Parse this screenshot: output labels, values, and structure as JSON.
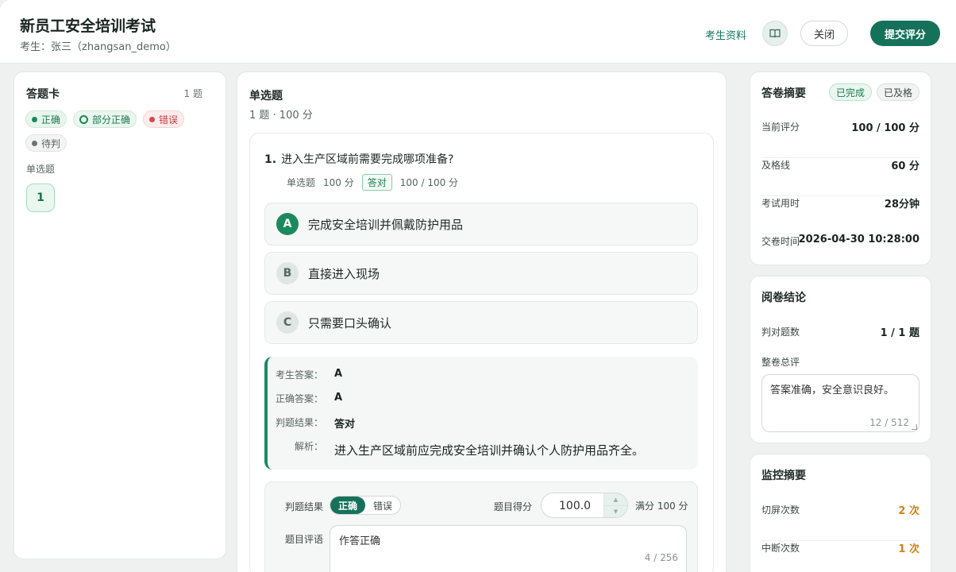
{
  "header": {
    "title": "新员工安全培训考试",
    "subtitle": "考生：张三（zhangsan_demo）",
    "profile_link": "考生资料",
    "book_icon": "book-icon",
    "close_label": "关闭",
    "submit_label": "提交评分"
  },
  "sheet": {
    "title": "答题卡",
    "count": "1 题",
    "legend": [
      {
        "label": "正确"
      },
      {
        "label": "部分正确"
      },
      {
        "label": "错误"
      },
      {
        "label": "待判"
      }
    ],
    "section": "单选题",
    "questions": [
      "1"
    ]
  },
  "main": {
    "section_title": "单选题",
    "section_meta": "1 题 · 100 分",
    "question": {
      "number": "1.",
      "text": "进入生产区域前需要完成哪项准备?",
      "type": "单选题",
      "points": "100 分",
      "result_tag": "答对",
      "score": "100 / 100 分",
      "options": [
        {
          "letter": "A",
          "text": "完成安全培训并佩戴防护用品",
          "selected": true
        },
        {
          "letter": "B",
          "text": "直接进入现场",
          "selected": false
        },
        {
          "letter": "C",
          "text": "只需要口头确认",
          "selected": false
        }
      ],
      "answer": {
        "student_label": "考生答案：",
        "student_value": "A",
        "correct_label": "正确答案：",
        "correct_value": "A",
        "result_label": "判题结果：",
        "result_value": "答对",
        "analysis_label": "解析：",
        "analysis_value": "进入生产区域前应完成安全培训并确认个人防护用品齐全。"
      },
      "grading": {
        "result_label": "判题结果",
        "correct_btn": "正确",
        "wrong_btn": "错误",
        "score_label": "题目得分",
        "score_value": "100.0",
        "full_score": "满分 100 分",
        "comment_label": "题目评语",
        "comment_value": "作答正确",
        "comment_count": "4 / 256"
      }
    }
  },
  "summary": {
    "title": "答卷摘要",
    "badges": [
      "已完成",
      "已及格"
    ],
    "rows": [
      {
        "k": "当前评分",
        "v": "100 / 100 分"
      },
      {
        "k": "及格线",
        "v": "60 分"
      },
      {
        "k": "考试用时",
        "v": "28分钟"
      },
      {
        "k": "交卷时间",
        "v": "2026-04-30 10:28:00"
      }
    ]
  },
  "conclusion": {
    "title": "阅卷结论",
    "correct_label": "判对题数",
    "correct_value": "1 / 1 题",
    "remark_label": "整卷总评",
    "remark_value": "答案准确，安全意识良好。",
    "remark_count": "12 / 512"
  },
  "monitor": {
    "title": "监控摘要",
    "rows": [
      {
        "k": "切屏次数",
        "v": "2 次"
      },
      {
        "k": "中断次数",
        "v": "1 次"
      }
    ]
  },
  "colors": {
    "accent": "#16715a",
    "correct": "#1a8a58",
    "wrong": "#d24a52",
    "warning": "#d0821a"
  }
}
